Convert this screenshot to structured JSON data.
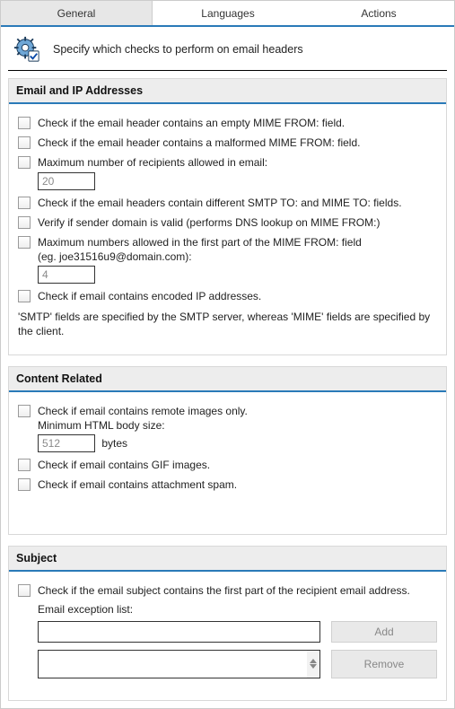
{
  "tabs": {
    "general": "General",
    "languages": "Languages",
    "actions": "Actions"
  },
  "intro": "Specify which checks to perform on email headers",
  "sections": {
    "email_ip": {
      "title": "Email and IP Addresses",
      "c1": "Check if the email header contains an empty MIME FROM: field.",
      "c2": "Check if the email header contains a malformed MIME FROM: field.",
      "c3": "Maximum number of recipients allowed in email:",
      "c3val": "20",
      "c4": "Check if the email headers contain different SMTP TO: and MIME TO: fields.",
      "c5": "Verify if sender domain is valid (performs DNS lookup on MIME FROM:)",
      "c6a": "Maximum numbers allowed in the first part of the MIME FROM: field",
      "c6b": "(eg. joe31516u9@domain.com):",
      "c6val": "4",
      "c7": "Check if email contains encoded IP addresses.",
      "note": "'SMTP' fields are specified by the SMTP server, whereas 'MIME' fields are specified by the client."
    },
    "content": {
      "title": "Content Related",
      "c1": "Check if email contains remote images only.",
      "c1sub": "Minimum HTML body size:",
      "c1val": "512",
      "c1unit": "bytes",
      "c2": "Check if email contains GIF images.",
      "c3": "Check if email contains attachment spam."
    },
    "subject": {
      "title": "Subject",
      "c1": "Check if the email subject contains the first part of the recipient email address.",
      "excl_label": "Email exception list:",
      "add": "Add",
      "remove": "Remove"
    }
  }
}
